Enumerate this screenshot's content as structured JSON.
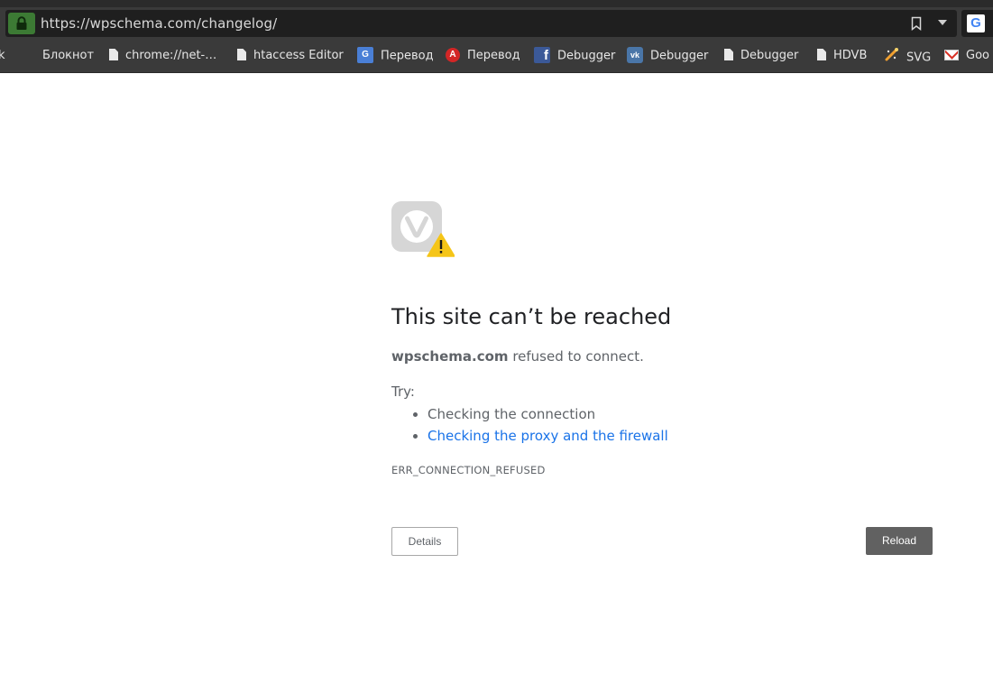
{
  "browser": {
    "url": "https://wpschema.com/changelog/",
    "search_engine_icon": "G"
  },
  "bookmarks": [
    {
      "label": "k",
      "icon": "none"
    },
    {
      "label": "Блокнот",
      "icon": "none"
    },
    {
      "label": "chrome://net-…",
      "icon": "doc-icon"
    },
    {
      "label": "htaccess Editor",
      "icon": "doc-icon"
    },
    {
      "label": "Перевод",
      "icon": "google-translate-icon",
      "icon_text": "G"
    },
    {
      "label": "Перевод",
      "icon": "translate-a-icon",
      "icon_text": "A"
    },
    {
      "label": "Debugger",
      "icon": "facebook-icon",
      "icon_text": "f"
    },
    {
      "label": "Debugger",
      "icon": "vk-icon",
      "icon_text": "vk"
    },
    {
      "label": "Debugger",
      "icon": "doc-icon"
    },
    {
      "label": "HDVB",
      "icon": "doc-icon"
    },
    {
      "label": "SVG",
      "icon": "svg-tool-icon"
    },
    {
      "label": "Goo",
      "icon": "gmail-icon"
    }
  ],
  "error": {
    "title": "This site can’t be reached",
    "host": "wpschema.com",
    "message": " refused to connect.",
    "try_label": "Try:",
    "suggestions": [
      {
        "text": "Checking the connection",
        "link": false
      },
      {
        "text": "Checking the proxy and the firewall",
        "link": true
      }
    ],
    "code": "ERR_CONNECTION_REFUSED",
    "details_button": "Details",
    "reload_button": "Reload"
  },
  "colors": {
    "link": "#1a73e8",
    "reload_bg": "#616161",
    "lock_bg": "#3c7a34",
    "chrome_bg": "#3a3a3a"
  }
}
